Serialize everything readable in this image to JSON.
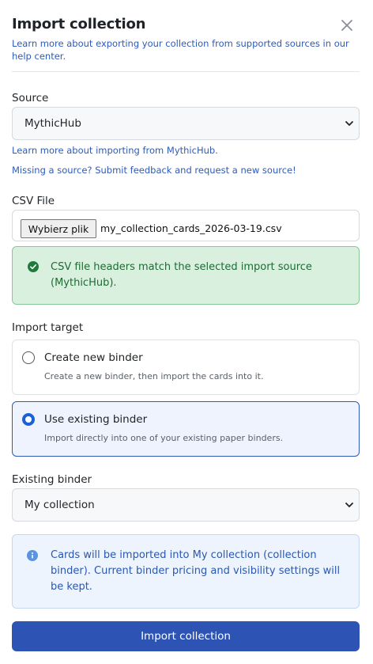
{
  "dialog": {
    "title": "Import collection",
    "close_icon": "close-icon",
    "help_text": "Learn more about exporting your collection from supported sources in our help center."
  },
  "source": {
    "label": "Source",
    "selected": "MythicHub",
    "learn_more": "Learn more about importing from MythicHub.",
    "missing": "Missing a source? Submit feedback and request a new source!"
  },
  "csv": {
    "label": "CSV File",
    "button_label": "Wybierz plik",
    "filename": "my_collection_cards_2026-03-19.csv",
    "success_message": "CSV file headers match the selected import source (MythicHub).",
    "success_color": "#1e6b34"
  },
  "import_target": {
    "label": "Import target",
    "options": [
      {
        "title": "Create new binder",
        "description": "Create a new binder, then import the cards into it.",
        "selected": false
      },
      {
        "title": "Use existing binder",
        "description": "Import directly into one of your existing paper binders.",
        "selected": true
      }
    ]
  },
  "existing_binder": {
    "label": "Existing binder",
    "selected": "My collection"
  },
  "info": {
    "message": "Cards will be imported into My collection (collection binder). Current binder pricing and visibility settings will be kept."
  },
  "actions": {
    "primary_label": "Import collection"
  },
  "colors": {
    "accent": "#2d54b5",
    "link": "#2e5bb8"
  }
}
